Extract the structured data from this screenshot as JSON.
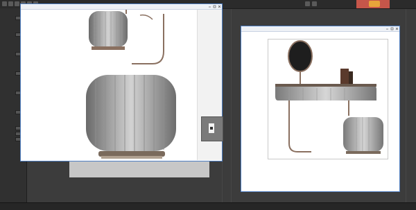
{
  "toolbar": {
    "badge_text": ""
  },
  "panel": {
    "rows": [
      {
        "label": "",
        "color": "orange"
      },
      {
        "label": "",
        "color": "white"
      },
      {
        "label": "",
        "color": "orange"
      },
      {
        "label": "",
        "color": "white"
      },
      {
        "label": "",
        "color": "orange"
      },
      {
        "label": "",
        "color": "white"
      },
      {
        "label": "",
        "color": "orange"
      },
      {
        "label": "",
        "color": "white"
      },
      {
        "label": "",
        "color": "orange"
      },
      {
        "label": "",
        "color": "white"
      },
      {
        "label": "",
        "color": "orange"
      },
      {
        "label": "",
        "color": "white"
      }
    ]
  },
  "viewer1": {
    "title": "",
    "icon": "image-viewer-icon"
  },
  "viewer2": {
    "title": "",
    "icon": "image-viewer-icon"
  },
  "timeline": {
    "ticks": [
      "",
      "",
      "",
      "",
      "",
      "",
      "",
      "",
      "",
      ""
    ]
  },
  "colors": {
    "window_border": "#4f7fc2",
    "panel_orange": "#e0903c",
    "badge_red": "#c6564a",
    "metal_bronze": "#8a7060"
  }
}
